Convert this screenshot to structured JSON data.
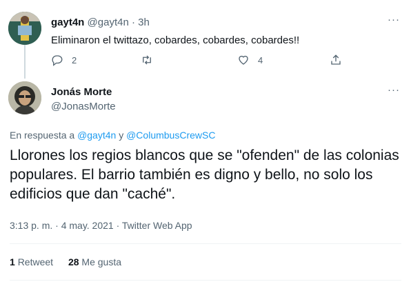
{
  "parent_tweet": {
    "display_name": "gayt4n",
    "handle": "@gayt4n",
    "time": "3h",
    "text": "Eliminaron el twittazo, cobardes, cobardes, cobardes!!",
    "more_label": "···",
    "reply_count": "2",
    "retweet_count": "",
    "like_count": "4"
  },
  "main_tweet": {
    "display_name": "Jonás Morte",
    "handle": "@JonasMorte",
    "more_label": "···",
    "reply_prefix": "En respuesta a",
    "reply_user_1": "@gayt4n",
    "reply_conj": "y",
    "reply_user_2": "@ColumbusCrewSC",
    "text": "Llorones los regios blancos que se \"ofenden\" de las colonias populares. El barrio también es digno y bello, no solo los edificios que dan \"caché\".",
    "timestamp": "3:13 p. m. · 4 may. 2021 · Twitter Web App",
    "retweets_count": "1",
    "retweets_label": "Retweet",
    "likes_count": "28",
    "likes_label": "Me gusta"
  },
  "icons": {
    "reply": "reply-icon",
    "retweet": "retweet-icon",
    "like": "heart-icon",
    "share": "share-icon",
    "more": "more-icon"
  },
  "colors": {
    "link": "#1d9bf0",
    "muted": "#536471",
    "text": "#0f1419"
  }
}
